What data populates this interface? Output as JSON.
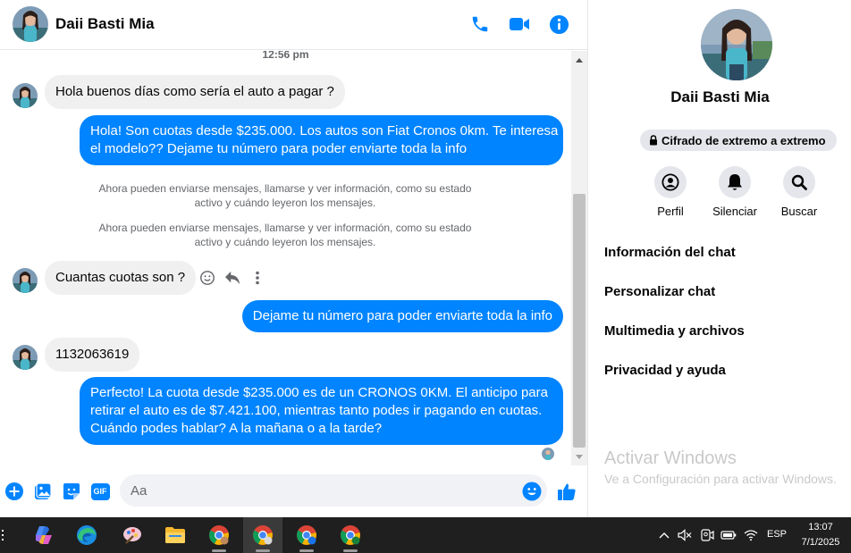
{
  "conversation": {
    "contact_name": "Daii Basti Mia"
  },
  "header": {
    "icons": [
      "phone-icon",
      "video-icon",
      "info-icon"
    ]
  },
  "messages": {
    "timestamp": "12:56 pm",
    "items": [
      {
        "direction": "in",
        "text": "Hola buenos días como sería el auto a pagar ?"
      },
      {
        "direction": "out",
        "lines": [
          "Hola! Son cuotas desde $235.000. Los autos son Fiat Cronos 0km. Te interesa",
          "el modelo?? Dejame tu número para poder enviarte toda la info"
        ]
      },
      {
        "direction": "system",
        "lines": [
          "Ahora pueden enviarse mensajes, llamarse y ver información, como su estado",
          "activo y cuándo leyeron los mensajes."
        ]
      },
      {
        "direction": "system",
        "lines": [
          "Ahora pueden enviarse mensajes, llamarse y ver información, como su estado",
          "activo y cuándo leyeron los mensajes."
        ]
      },
      {
        "direction": "in",
        "text": "Cuantas cuotas son ?"
      },
      {
        "direction": "out",
        "text": "Dejame tu número para poder enviarte toda la info"
      },
      {
        "direction": "in",
        "text": "1132063619"
      },
      {
        "direction": "out",
        "lines": [
          "Perfecto! La cuota desde $235.000 es de un CRONOS 0KM. El anticipo para",
          "retirar el auto es de $7.421.100, mientras tanto podes ir pagando en cuotas.",
          "Cuándo podes hablar? A la mañana o a la tarde?"
        ]
      }
    ],
    "hover_actions": [
      "emoji-reaction-icon",
      "reply-icon",
      "more-options-icon"
    ]
  },
  "composer": {
    "placeholder": "Aa",
    "icons": [
      "plus-icon",
      "gallery-icon",
      "sticker-icon",
      "gif-icon",
      "emoji-icon",
      "like-icon"
    ],
    "gif_label": "GIF"
  },
  "info_panel": {
    "name": "Daii Basti Mia",
    "encryption_badge": "Cifrado de extremo a extremo",
    "quick_actions": [
      {
        "label": "Perfil",
        "icon": "profile-icon"
      },
      {
        "label": "Silenciar",
        "icon": "bell-icon"
      },
      {
        "label": "Buscar",
        "icon": "search-icon"
      }
    ],
    "sections": [
      "Información del chat",
      "Personalizar chat",
      "Multimedia y archivos",
      "Privacidad y ayuda"
    ]
  },
  "watermark": {
    "title": "Activar Windows",
    "subtitle": "Ve a Configuración para activar Windows."
  },
  "taskbar": {
    "apps": [
      "copilot-icon",
      "edge-icon",
      "paint-icon",
      "file-explorer-icon",
      "chrome-icon",
      "chrome-profile-icon",
      "chrome-v-icon",
      "chrome-t-icon"
    ],
    "language": "ESP",
    "time": "13:07",
    "date": "7/1/2025"
  },
  "colors": {
    "accent": "#0084ff",
    "incoming_bubble": "#f0f0f0",
    "taskbar": "#1f1f1f"
  }
}
